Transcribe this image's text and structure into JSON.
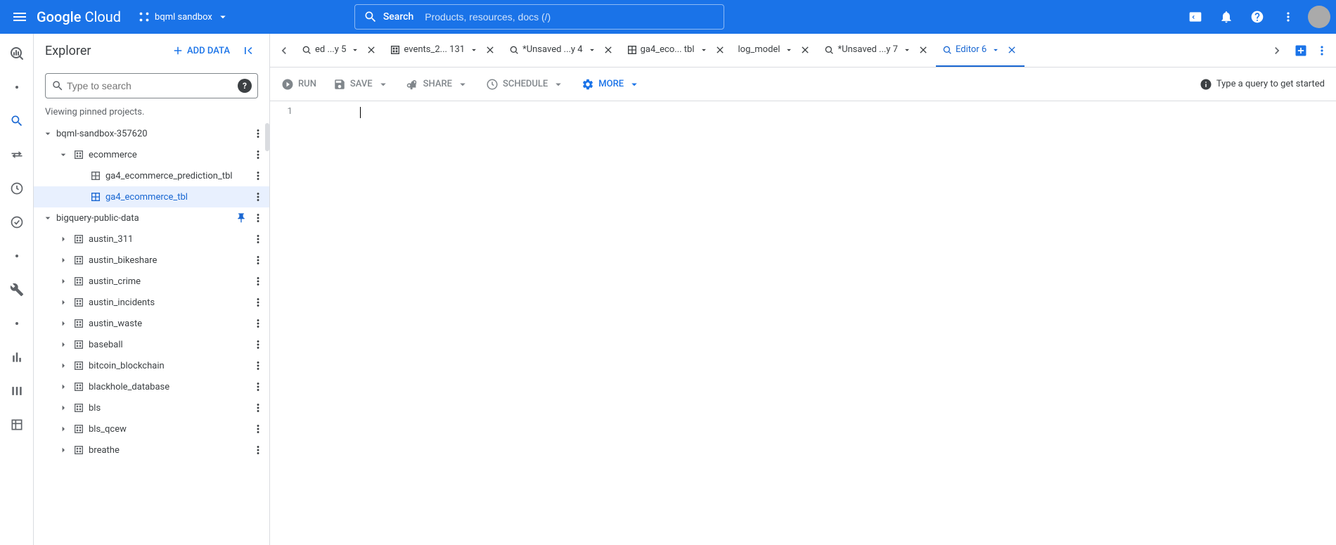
{
  "header": {
    "logo": "Google Cloud",
    "project": "bqml sandbox",
    "search_label": "Search",
    "search_placeholder": "Products, resources, docs (/)"
  },
  "explorer": {
    "title": "Explorer",
    "add_data_label": "ADD DATA",
    "search_placeholder": "Type to search",
    "viewing_text": "Viewing pinned projects.",
    "tree": [
      {
        "label": "bqml-sandbox-357620",
        "expanded": true,
        "children": [
          {
            "label": "ecommerce",
            "type": "dataset",
            "expanded": true,
            "children": [
              {
                "label": "ga4_ecommerce_prediction_tbl",
                "type": "table"
              },
              {
                "label": "ga4_ecommerce_tbl",
                "type": "table",
                "selected": true
              }
            ]
          }
        ]
      },
      {
        "label": "bigquery-public-data",
        "expanded": true,
        "pinned": true,
        "children": [
          {
            "label": "austin_311",
            "type": "dataset"
          },
          {
            "label": "austin_bikeshare",
            "type": "dataset"
          },
          {
            "label": "austin_crime",
            "type": "dataset"
          },
          {
            "label": "austin_incidents",
            "type": "dataset"
          },
          {
            "label": "austin_waste",
            "type": "dataset"
          },
          {
            "label": "baseball",
            "type": "dataset"
          },
          {
            "label": "bitcoin_blockchain",
            "type": "dataset"
          },
          {
            "label": "blackhole_database",
            "type": "dataset"
          },
          {
            "label": "bls",
            "type": "dataset"
          },
          {
            "label": "bls_qcew",
            "type": "dataset"
          },
          {
            "label": "breathe",
            "type": "dataset"
          }
        ]
      }
    ]
  },
  "tabs": [
    {
      "label": "ed ...y 5",
      "icon": "query",
      "partial_left": true
    },
    {
      "label": "events_2... 131",
      "icon": "table_partition"
    },
    {
      "label": "*Unsaved ...y 4",
      "icon": "query"
    },
    {
      "label": "ga4_eco... tbl",
      "icon": "table"
    },
    {
      "label": "log_model",
      "icon": "none"
    },
    {
      "label": "*Unsaved ...y 7",
      "icon": "query"
    },
    {
      "label": "Editor 6",
      "icon": "query",
      "active": true
    }
  ],
  "toolbar": {
    "run": "RUN",
    "save": "SAVE",
    "share": "SHARE",
    "schedule": "SCHEDULE",
    "more": "MORE",
    "hint": "Type a query to get started"
  },
  "editor": {
    "line_numbers": [
      "1"
    ]
  }
}
